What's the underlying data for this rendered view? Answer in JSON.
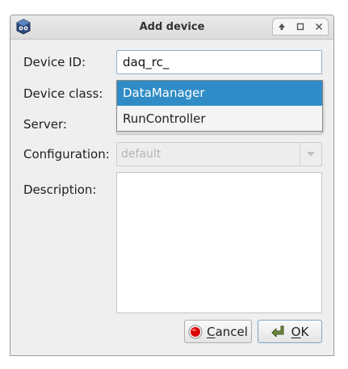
{
  "window": {
    "title": "Add device",
    "app_icon": "application-icon",
    "controls": [
      "shade-icon",
      "maximize-icon",
      "close-icon"
    ]
  },
  "form": {
    "device_id": {
      "label": "Device ID:",
      "value": "daq_rc_"
    },
    "device_class": {
      "label": "Device class:",
      "options": [
        "DataManager",
        "RunController"
      ],
      "highlighted": "DataManager"
    },
    "server": {
      "label": "Server:"
    },
    "configuration": {
      "label": "Configuration:",
      "value": "default",
      "disabled": true
    },
    "description": {
      "label": "Description:",
      "value": ""
    }
  },
  "buttons": {
    "cancel": {
      "mnemonic": "C",
      "rest": "ancel",
      "icon": "stop-icon"
    },
    "ok": {
      "mnemonic": "O",
      "rest": "K",
      "icon": "check-arrow-icon"
    }
  },
  "colors": {
    "selection": "#308cc6",
    "window_bg": "#efefef",
    "cancel_icon": "#d90000",
    "ok_icon": "#6d8a3c"
  }
}
